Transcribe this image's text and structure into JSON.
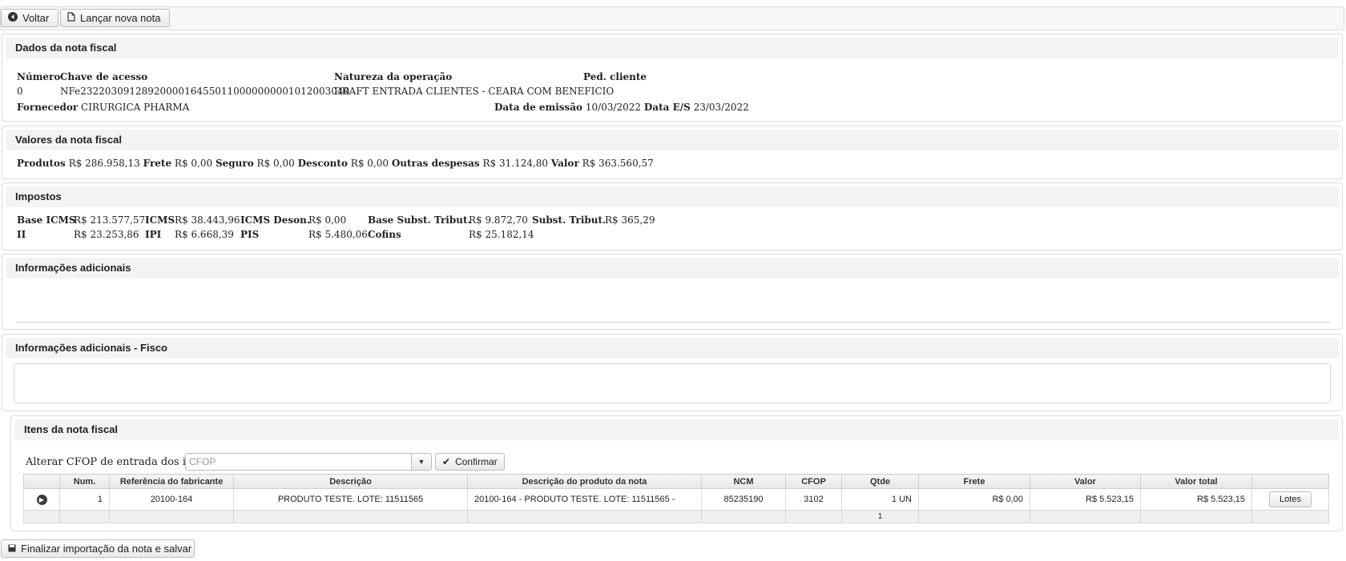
{
  "toolbar": {
    "back_label": "Voltar",
    "new_note_label": "Lançar nova nota"
  },
  "dados": {
    "title": "Dados da nota fiscal",
    "numero_label": "Número",
    "numero_value": "0",
    "chave_label": "Chave de acesso",
    "chave_value": "NFe23220309128920000164550110000000001012003040",
    "natureza_label": "Natureza da operação",
    "natureza_value": "DRAFT ENTRADA CLIENTES - CEARA COM BENEFICIO",
    "ped_label": "Ped. cliente",
    "fornecedor_label": "Fornecedor",
    "fornecedor_value": "CIRURGICA PHARMA",
    "emissao_label": "Data de emissão",
    "emissao_value": "10/03/2022",
    "es_label": "Data E/S",
    "es_value": "23/03/2022"
  },
  "valores": {
    "title": "Valores da nota fiscal",
    "produtos_label": "Produtos",
    "produtos_value": "R$ 286.958,13",
    "frete_label": "Frete",
    "frete_value": "R$ 0,00",
    "seguro_label": "Seguro",
    "seguro_value": "R$ 0,00",
    "desconto_label": "Desconto",
    "desconto_value": "R$ 0,00",
    "outras_label": "Outras despesas",
    "outras_value": "R$ 31.124,80",
    "valor_label": "Valor",
    "valor_value": "R$ 363.560,57"
  },
  "impostos": {
    "title": "Impostos",
    "base_icms_label": "Base ICMS",
    "base_icms_value": "R$ 213.577,57",
    "icms_label": "ICMS",
    "icms_value": "R$ 38.443,96",
    "icms_deson_label": "ICMS Deson.",
    "icms_deson_value": "R$ 0,00",
    "base_st_label": "Base Subst. Tribut.",
    "base_st_value": "R$ 9.872,70",
    "st_label": "Subst. Tribut.",
    "st_value": "R$ 365,29",
    "ii_label": "II",
    "ii_value": "R$ 23.253,86",
    "ipi_label": "IPI",
    "ipi_value": "R$ 6.668,39",
    "pis_label": "PIS",
    "pis_value": "R$ 5.480,06",
    "cofins_label": "Cofins",
    "cofins_value": "R$ 25.182,14"
  },
  "info": {
    "title": "Informações adicionais"
  },
  "fisco": {
    "title": "Informações adicionais - Fisco"
  },
  "itens": {
    "title": "Itens da nota fiscal",
    "cfop_label": "Alterar CFOP de entrada dos itens",
    "cfop_placeholder": "CFOP",
    "confirm_label": "Confirmar",
    "columns": [
      "Num.",
      "Referência do fabricante",
      "Descrição",
      "Descrição do produto da nota",
      "NCM",
      "CFOP",
      "Qtde",
      "Frete",
      "Valor",
      "Valor total"
    ],
    "rows": [
      {
        "num": "1",
        "ref": "20100-164",
        "descricao": "PRODUTO TESTE. LOTE: 11511565",
        "descricao_nota": "20100-164 - PRODUTO TESTE. LOTE: 11511565 -",
        "ncm": "85235190",
        "cfop": "3102",
        "qtde": "1 UN",
        "frete": "R$ 0,00",
        "valor": "R$ 5.523,15",
        "valor_total": "R$ 5.523,15",
        "lotes_label": "Lotes"
      }
    ],
    "footer_qtde": "1"
  },
  "finalize_label": "Finalizar importação da nota e salvar"
}
